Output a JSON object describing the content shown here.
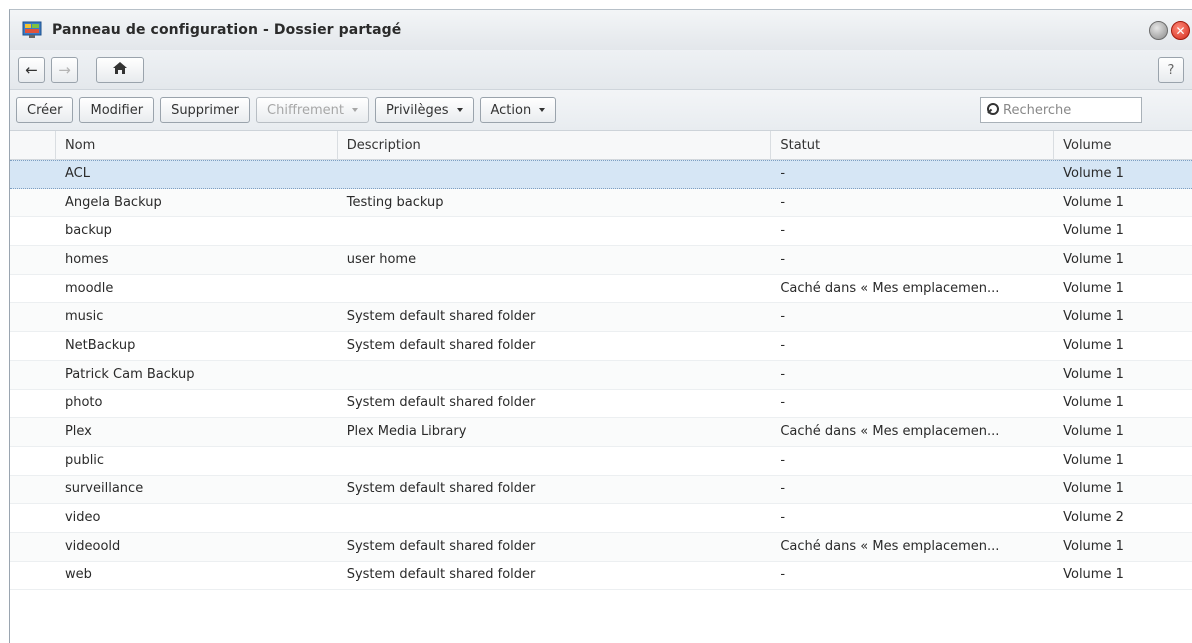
{
  "window": {
    "title": "Panneau de configuration - Dossier partagé"
  },
  "nav": {
    "back_icon": "arrow-left-icon",
    "forward_icon": "arrow-right-icon",
    "home_icon": "home-icon",
    "help_label": "?"
  },
  "toolbar": {
    "create": "Créer",
    "modify": "Modifier",
    "delete": "Supprimer",
    "encryption": "Chiffrement",
    "privileges": "Privilèges",
    "action": "Action",
    "search_placeholder": "Recherche"
  },
  "table": {
    "headers": {
      "name": "Nom",
      "description": "Description",
      "status": "Statut",
      "volume": "Volume"
    },
    "rows": [
      {
        "name": "ACL",
        "description": "",
        "status": "-",
        "volume": "Volume 1",
        "selected": true
      },
      {
        "name": "Angela Backup",
        "description": "Testing backup",
        "status": "-",
        "volume": "Volume 1"
      },
      {
        "name": "backup",
        "description": "",
        "status": "-",
        "volume": "Volume 1"
      },
      {
        "name": "homes",
        "description": "user home",
        "status": "-",
        "volume": "Volume 1"
      },
      {
        "name": "moodle",
        "description": "",
        "status": "Caché dans « Mes emplacemen...",
        "volume": "Volume 1"
      },
      {
        "name": "music",
        "description": "System default shared folder",
        "status": "-",
        "volume": "Volume 1"
      },
      {
        "name": "NetBackup",
        "description": "System default shared folder",
        "status": "-",
        "volume": "Volume 1"
      },
      {
        "name": "Patrick Cam Backup",
        "description": "",
        "status": "-",
        "volume": "Volume 1"
      },
      {
        "name": "photo",
        "description": "System default shared folder",
        "status": "-",
        "volume": "Volume 1"
      },
      {
        "name": "Plex",
        "description": "Plex Media Library",
        "status": "Caché dans « Mes emplacemen...",
        "volume": "Volume 1"
      },
      {
        "name": "public",
        "description": "",
        "status": "-",
        "volume": "Volume 1"
      },
      {
        "name": "surveillance",
        "description": "System default shared folder",
        "status": "-",
        "volume": "Volume 1"
      },
      {
        "name": "video",
        "description": "",
        "status": "-",
        "volume": "Volume 2"
      },
      {
        "name": "videoold",
        "description": "System default shared folder",
        "status": "Caché dans « Mes emplacemen...",
        "volume": "Volume 1"
      },
      {
        "name": "web",
        "description": "System default shared folder",
        "status": "-",
        "volume": "Volume 1"
      }
    ]
  },
  "colors": {
    "selected_row": "#d6e6f5",
    "close_button": "#d22a1a"
  }
}
